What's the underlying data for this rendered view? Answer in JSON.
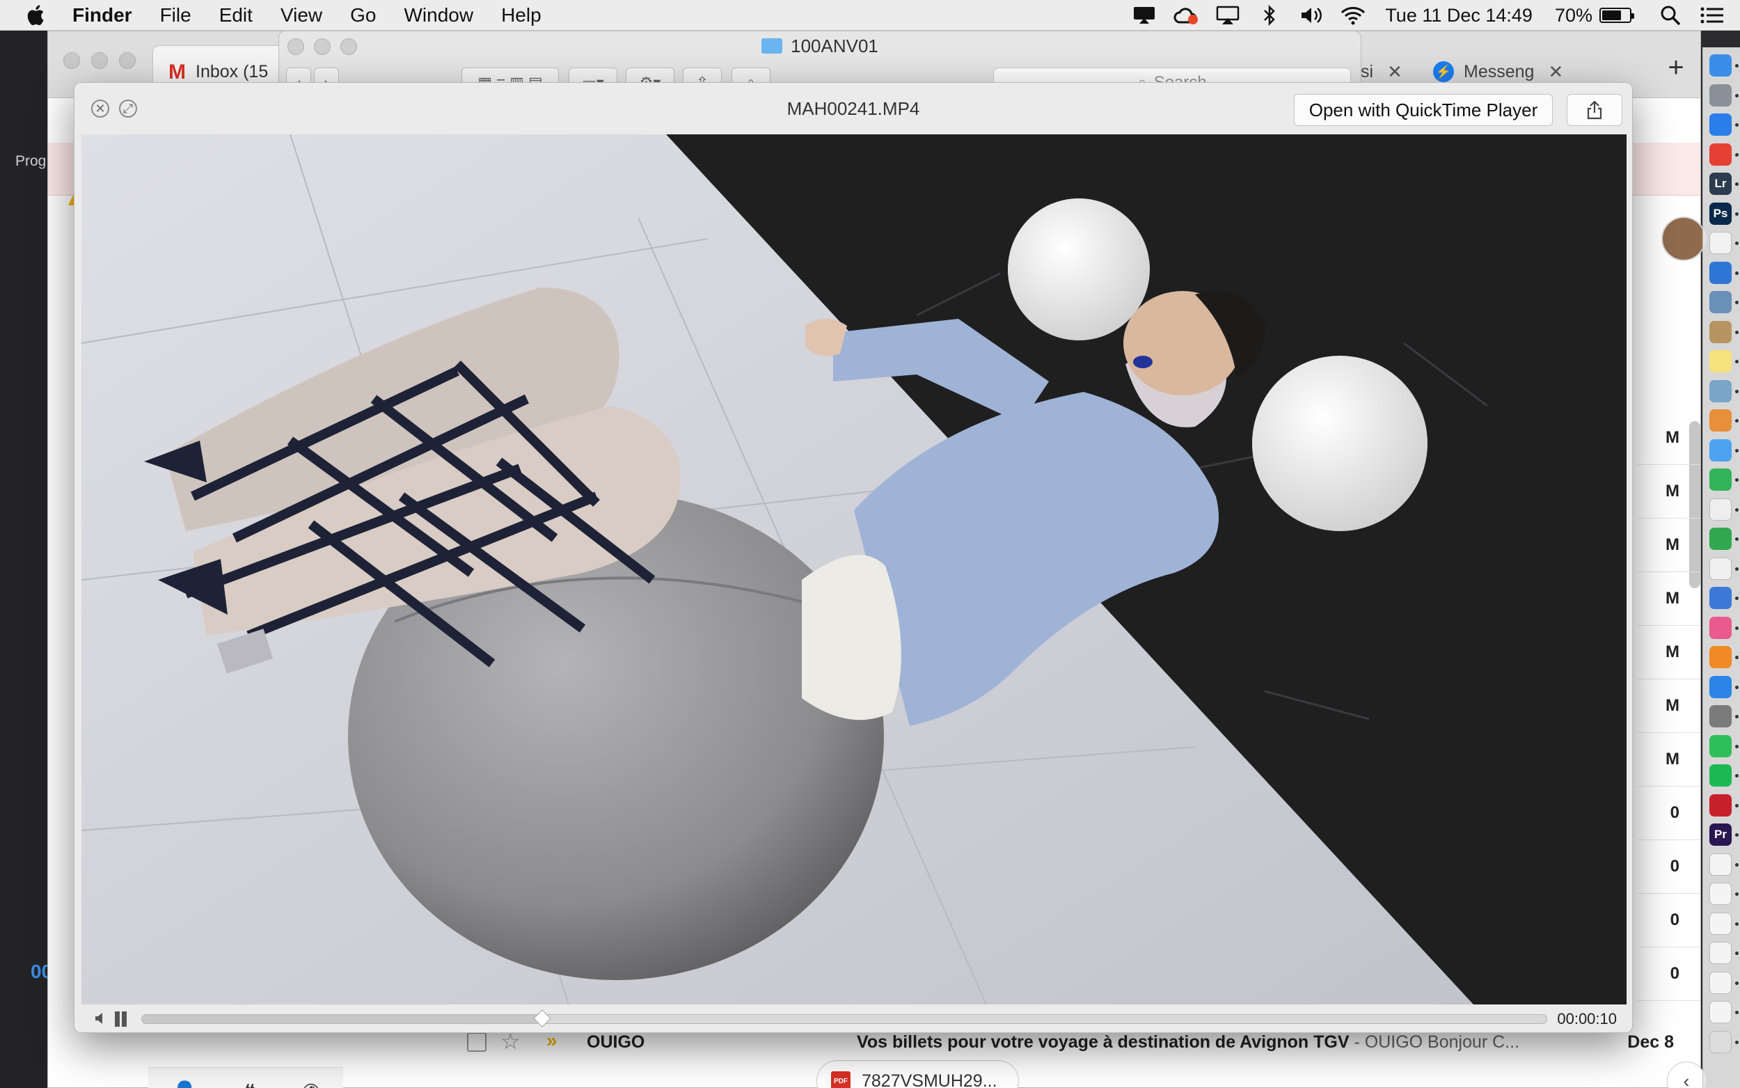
{
  "menubar": {
    "app": "Finder",
    "items": [
      "File",
      "Edit",
      "View",
      "Go",
      "Window",
      "Help"
    ],
    "clock": "Tue 11 Dec  14:49",
    "battery_label": "70%",
    "battery_level": 0.7,
    "status_icons": [
      "display-mirroring-icon",
      "creative-cloud-icon",
      "airplay-icon",
      "bluetooth-icon",
      "volume-icon",
      "wifi-icon",
      "battery-icon",
      "spotlight-icon",
      "notification-center-icon"
    ]
  },
  "premiere": {
    "label": "Prog",
    "timecode": "00"
  },
  "browser": {
    "tab_gmail": "Inbox (15",
    "tab_partial": "si",
    "tab_messenger": "Messeng",
    "new_tab": "+",
    "row_letters": [
      "M",
      "M",
      "M",
      "M",
      "M",
      "M",
      "M",
      "0",
      "0",
      "0",
      "0"
    ],
    "email": {
      "sender": "OUIGO",
      "subject": "Vos billets pour votre voyage à destination de Avignon TGV",
      "snippet": " - OUIGO Bonjour C...",
      "date": "Dec 8",
      "attachment": "7827VSMUH29..."
    }
  },
  "finder": {
    "title": "100ANV01",
    "search_placeholder": "Search"
  },
  "quicklook": {
    "title": "MAH00241.MP4",
    "open_button": "Open with QuickTime Player",
    "time": "00:00:10",
    "progress": 0.285
  },
  "dock_icons": [
    {
      "name": "finder-icon",
      "color": "#3b8ee8",
      "label": ""
    },
    {
      "name": "launchpad-icon",
      "color": "#8a8f99",
      "label": ""
    },
    {
      "name": "safari-icon",
      "color": "#2b7de9",
      "label": ""
    },
    {
      "name": "chrome-icon",
      "color": "#e54033",
      "label": ""
    },
    {
      "name": "lightroom-icon",
      "color": "#2d3b4e",
      "label": "Lr"
    },
    {
      "name": "photoshop-icon",
      "color": "#0b2a4b",
      "label": "Ps"
    },
    {
      "name": "calendar-icon",
      "color": "#f2f2f2",
      "label": ""
    },
    {
      "name": "1password-icon",
      "color": "#2f75d6",
      "label": ""
    },
    {
      "name": "preview-icon",
      "color": "#6a8fb8",
      "label": ""
    },
    {
      "name": "contacts-icon",
      "color": "#b69563",
      "label": ""
    },
    {
      "name": "notes-icon",
      "color": "#f6e27a",
      "label": ""
    },
    {
      "name": "image-capture-icon",
      "color": "#7aa4c8",
      "label": ""
    },
    {
      "name": "photos-icon",
      "color": "#e78f3b",
      "label": ""
    },
    {
      "name": "messages-icon",
      "color": "#4da3f0",
      "label": ""
    },
    {
      "name": "facetime-icon",
      "color": "#33b35a",
      "label": ""
    },
    {
      "name": "reminders-icon",
      "color": "#eeeeee",
      "label": ""
    },
    {
      "name": "numbers-icon",
      "color": "#2fa84f",
      "label": ""
    },
    {
      "name": "pages-icon",
      "color": "#f0f0f0",
      "label": ""
    },
    {
      "name": "keynote-icon",
      "color": "#3d7ad8",
      "label": ""
    },
    {
      "name": "itunes-icon",
      "color": "#ea5a8c",
      "label": ""
    },
    {
      "name": "ibooks-icon",
      "color": "#f08a24",
      "label": ""
    },
    {
      "name": "app-store-icon",
      "color": "#2b84e8",
      "label": ""
    },
    {
      "name": "system-preferences-icon",
      "color": "#7b7b7b",
      "label": ""
    },
    {
      "name": "whatsapp-icon",
      "color": "#2fbf5a",
      "label": ""
    },
    {
      "name": "spotify-icon",
      "color": "#1db954",
      "label": ""
    },
    {
      "name": "acrobat-icon",
      "color": "#c8202b",
      "label": ""
    },
    {
      "name": "premiere-icon",
      "color": "#2a1650",
      "label": "Pr"
    },
    {
      "name": "document-thumb-icon",
      "color": "#f4f4f4",
      "label": ""
    },
    {
      "name": "document-thumb-icon",
      "color": "#f4f4f4",
      "label": ""
    },
    {
      "name": "document-thumb-icon",
      "color": "#f4f4f4",
      "label": ""
    },
    {
      "name": "document-thumb-icon",
      "color": "#f4f4f4",
      "label": ""
    },
    {
      "name": "document-thumb-icon",
      "color": "#f4f4f4",
      "label": ""
    },
    {
      "name": "document-thumb-icon",
      "color": "#f4f4f4",
      "label": ""
    },
    {
      "name": "trash-icon",
      "color": "#dcdcdc",
      "label": ""
    }
  ]
}
